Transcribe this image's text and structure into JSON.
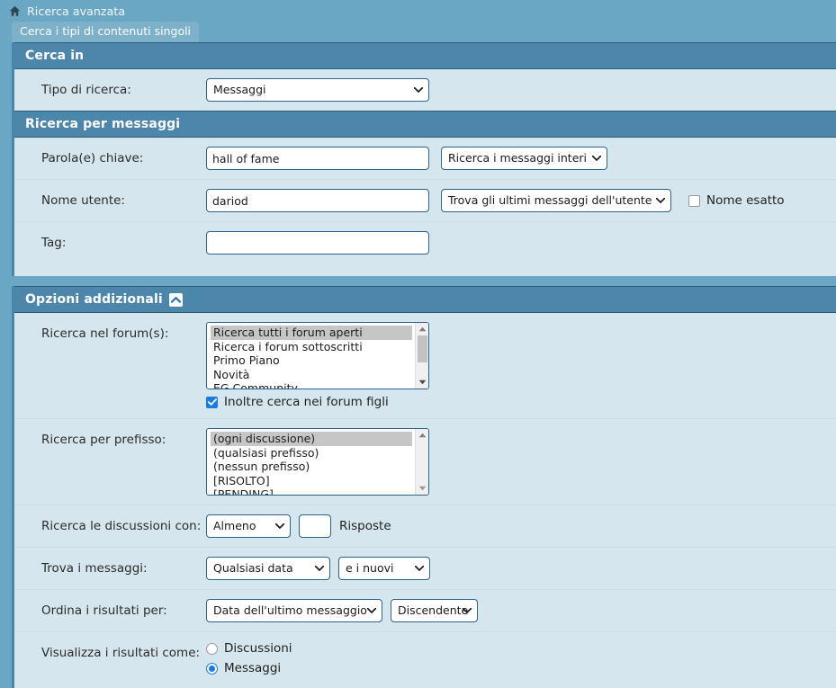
{
  "breadcrumb": {
    "home_icon": "home-icon",
    "label": "Ricerca avanzata"
  },
  "tab": {
    "label": "Cerca i tipi di contenuti singoli"
  },
  "colors": {
    "page_bg": "#6aa7c4",
    "panel_bg": "#d6e6ee",
    "panel_head_bg": "#4d86ab",
    "accent_border": "#2e6389",
    "checked_blue": "#1a7ce0",
    "listbox_selected": "#c6c6c6"
  },
  "sections": {
    "search_in": {
      "title": "Cerca in",
      "search_type": {
        "label": "Tipo di ricerca:",
        "value": "Messaggi"
      }
    },
    "search_posts": {
      "title": "Ricerca per messaggi",
      "keywords": {
        "label": "Parola(e) chiave:",
        "value": "hall of fame",
        "placeholder": "",
        "mode": "Ricerca i messaggi interi"
      },
      "username": {
        "label": "Nome utente:",
        "value": "dariod",
        "placeholder": "",
        "mode": "Trova gli ultimi messaggi dell'utente",
        "exact_label": "Nome esatto",
        "exact_checked": false
      },
      "tag": {
        "label": "Tag:",
        "value": "",
        "placeholder": ""
      }
    },
    "additional": {
      "title": "Opzioni addizionali",
      "collapse_icon": "chevron-up-icon",
      "forums": {
        "label": "Ricerca nel forum(s):",
        "options": [
          "Ricerca tutti i forum aperti",
          "Ricerca i forum sottoscritti",
          "Primo Piano",
          "Novità",
          "EG Community"
        ],
        "selected": "Ricerca tutti i forum aperti",
        "child_forums_label": "Inoltre cerca nei forum figli",
        "child_forums_checked": true
      },
      "prefix": {
        "label": "Ricerca per prefisso:",
        "options": [
          "(ogni discussione)",
          "(qualsiasi prefisso)",
          "(nessun prefisso)",
          "[RISOLTO]",
          "[PENDING]"
        ],
        "selected": "(ogni discussione)"
      },
      "replies": {
        "label": "Ricerca le discussioni con:",
        "operator": "Almeno",
        "count": "",
        "suffix": "Risposte"
      },
      "find_posts": {
        "label": "Trova i messaggi:",
        "date": "Qualsiasi data",
        "direction": "e i nuovi"
      },
      "sort": {
        "label": "Ordina i risultati per:",
        "field": "Data dell'ultimo messaggio",
        "order": "Discendente"
      },
      "display": {
        "label": "Visualizza i risultati come:",
        "option_threads": "Discussioni",
        "option_posts": "Messaggi",
        "selected": "Messaggi"
      }
    }
  }
}
